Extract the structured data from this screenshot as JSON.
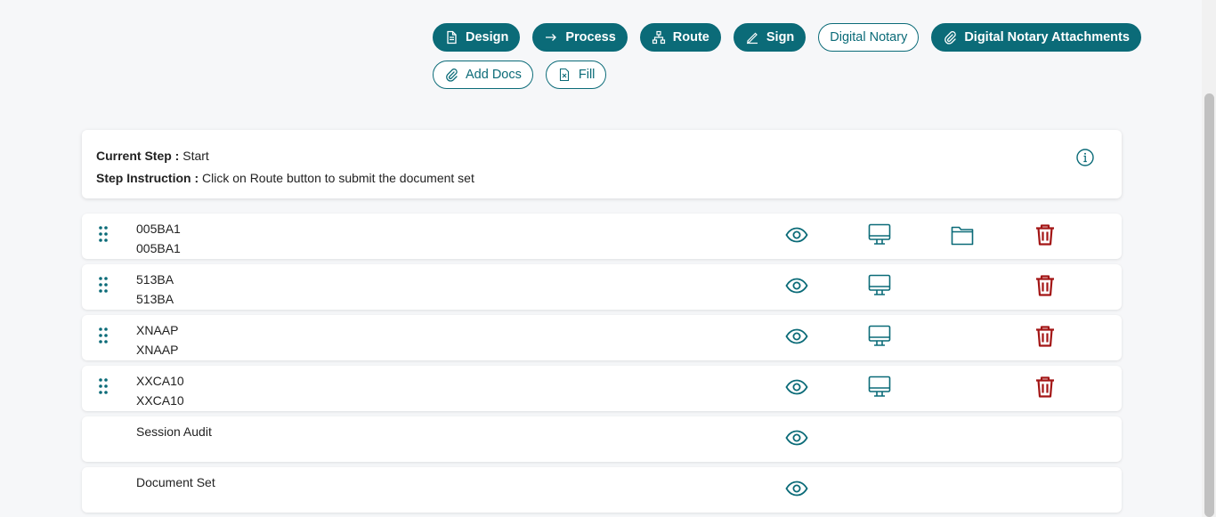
{
  "toolbar": {
    "row1": [
      {
        "label": "Design",
        "icon": "document-icon",
        "style": "solid"
      },
      {
        "label": "Process",
        "icon": "arrow-right-icon",
        "style": "solid"
      },
      {
        "label": "Route",
        "icon": "hierarchy-icon",
        "style": "solid"
      },
      {
        "label": "Sign",
        "icon": "pen-icon",
        "style": "solid"
      },
      {
        "label": "Digital Notary",
        "icon": "",
        "style": "outline"
      },
      {
        "label": "Digital Notary Attachments",
        "icon": "paperclip-icon",
        "style": "solid"
      }
    ],
    "row2": [
      {
        "label": "Add Docs",
        "icon": "paperclip-icon",
        "style": "outline"
      },
      {
        "label": "Fill",
        "icon": "excel-file-icon",
        "style": "outline"
      }
    ]
  },
  "step": {
    "current_label": "Current Step :",
    "current_value": "Start",
    "instruction_label": "Step Instruction :",
    "instruction_value": "Click on Route button to submit the document set"
  },
  "documents": [
    {
      "line1": "005BA1",
      "line2": "005BA1",
      "draggable": true,
      "actions": [
        "view",
        "desktop",
        "folder",
        "trash"
      ]
    },
    {
      "line1": "513BA",
      "line2": "513BA",
      "draggable": true,
      "actions": [
        "view",
        "desktop",
        "trash"
      ]
    },
    {
      "line1": "XNAAP",
      "line2": "XNAAP",
      "draggable": true,
      "actions": [
        "view",
        "desktop",
        "trash"
      ]
    },
    {
      "line1": "XXCA10",
      "line2": "XXCA10",
      "draggable": true,
      "actions": [
        "view",
        "desktop",
        "trash"
      ]
    },
    {
      "line1": "Session Audit",
      "line2": "",
      "draggable": false,
      "actions": [
        "view"
      ]
    },
    {
      "line1": "Document Set",
      "line2": "",
      "draggable": false,
      "actions": [
        "view"
      ]
    }
  ],
  "colors": {
    "primary": "#0b6b78",
    "danger": "#a31515",
    "background": "#f6f7f9"
  }
}
